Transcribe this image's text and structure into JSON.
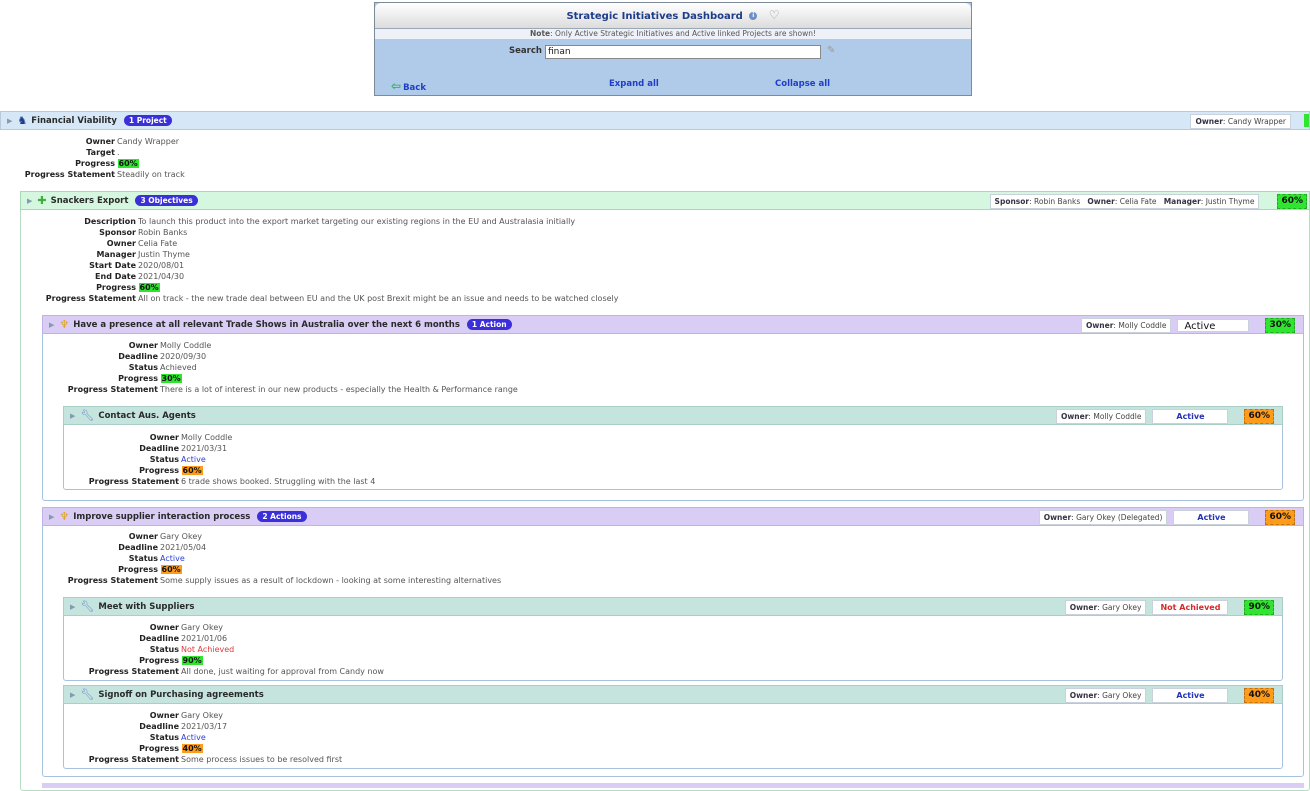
{
  "header": {
    "title": "Strategic Initiatives Dashboard",
    "info_icon": "info-icon",
    "fav_icon": "heart-icon",
    "note_prefix": "Note",
    "note_text": ": Only Active Strategic Initiatives and Active linked Projects are shown!",
    "search_label": "Search",
    "search_value": "finan",
    "back_label": "Back",
    "expand_label": "Expand all",
    "collapse_label": "Collapse all"
  },
  "initiative": {
    "title": "Financial Viability",
    "badge": "1 Project",
    "owner_label": "Owner",
    "owner_value": "Candy Wrapper",
    "details": {
      "owner_l": "Owner",
      "owner": "Candy Wrapper",
      "target_l": "Target",
      "target": ".",
      "progress_l": "Progress",
      "progress": "60%",
      "statement_l": "Progress Statement",
      "statement": "Steadily on track"
    }
  },
  "project": {
    "title": "Snackers Export",
    "badge": "3 Objectives",
    "sponsor_l": "Sponsor",
    "sponsor": "Robin Banks",
    "owner_l": "Owner",
    "owner": "Celia Fate",
    "manager_l": "Manager",
    "manager": "Justin Thyme",
    "pct": "60%",
    "details": {
      "description_l": "Description",
      "description": "To launch this product into the export market targeting our existing regions in the EU and Australasia initially",
      "sponsor_l": "Sponsor",
      "sponsor": "Robin Banks",
      "owner_l": "Owner",
      "owner": "Celia Fate",
      "manager_l": "Manager",
      "manager": "Justin Thyme",
      "start_l": "Start Date",
      "start": "2020/08/01",
      "end_l": "End Date",
      "end": "2021/04/30",
      "progress_l": "Progress",
      "progress": "60%",
      "statement_l": "Progress Statement",
      "statement": "All on track - the new trade deal between EU and the UK post Brexit might be an issue and needs to be watched closely"
    }
  },
  "objectives": [
    {
      "title": "Have a presence at all relevant Trade Shows in Australia over the next 6 months",
      "badge": "1 Action",
      "owner_l": "Owner",
      "owner": "Molly Coddle",
      "status": "Active",
      "pct": "30%",
      "details": {
        "owner_l": "Owner",
        "owner": "Molly Coddle",
        "deadline_l": "Deadline",
        "deadline": "2020/09/30",
        "status_l": "Status",
        "status": "Achieved",
        "progress_l": "Progress",
        "progress": "30%",
        "statement_l": "Progress Statement",
        "statement": "There is a lot of interest in our new products - especially the Health & Performance range"
      },
      "actions": [
        {
          "title": "Contact Aus. Agents",
          "owner_l": "Owner",
          "owner": "Molly Coddle",
          "status": "Active",
          "pct": "60%",
          "details": {
            "owner_l": "Owner",
            "owner": "Molly Coddle",
            "deadline_l": "Deadline",
            "deadline": "2021/03/31",
            "status_l": "Status",
            "status": "Active",
            "progress_l": "Progress",
            "progress": "60%",
            "statement_l": "Progress Statement",
            "statement": "6 trade shows booked. Struggling with the last 4"
          }
        }
      ]
    },
    {
      "title": "Improve supplier interaction process",
      "badge": "2 Actions",
      "owner_l": "Owner",
      "owner": "Gary Okey (Delegated)",
      "status": "Active",
      "pct": "60%",
      "details": {
        "owner_l": "Owner",
        "owner": "Gary Okey",
        "deadline_l": "Deadline",
        "deadline": "2021/05/04",
        "status_l": "Status",
        "status": "Active",
        "progress_l": "Progress",
        "progress": "60%",
        "statement_l": "Progress Statement",
        "statement": "Some supply issues as a result of lockdown - looking at some interesting alternatives"
      },
      "actions": [
        {
          "title": "Meet with Suppliers",
          "owner_l": "Owner",
          "owner": "Gary Okey",
          "status": "Not Achieved",
          "pct": "90%",
          "details": {
            "owner_l": "Owner",
            "owner": "Gary Okey",
            "deadline_l": "Deadline",
            "deadline": "2021/01/06",
            "status_l": "Status",
            "status": "Not Achieved",
            "progress_l": "Progress",
            "progress": "90%",
            "statement_l": "Progress Statement",
            "statement": "All done, just waiting for approval from Candy now"
          }
        },
        {
          "title": "Signoff on Purchasing agreements",
          "owner_l": "Owner",
          "owner": "Gary Okey",
          "status": "Active",
          "pct": "40%",
          "details": {
            "owner_l": "Owner",
            "owner": "Gary Okey",
            "deadline_l": "Deadline",
            "deadline": "2021/03/17",
            "status_l": "Status",
            "status": "Active",
            "progress_l": "Progress",
            "progress": "40%",
            "statement_l": "Progress Statement",
            "statement": "Some process issues to be resolved first"
          }
        }
      ]
    }
  ],
  "colors": {
    "initiative_row": "#d6e8f7",
    "project_row": "#d5f7e0",
    "objective_row": "#d9ccf5",
    "action_row": "#c5e4de",
    "badge": "#3a2fd8",
    "progress_green": "#2fe52f",
    "progress_orange": "#ff9b1a"
  }
}
